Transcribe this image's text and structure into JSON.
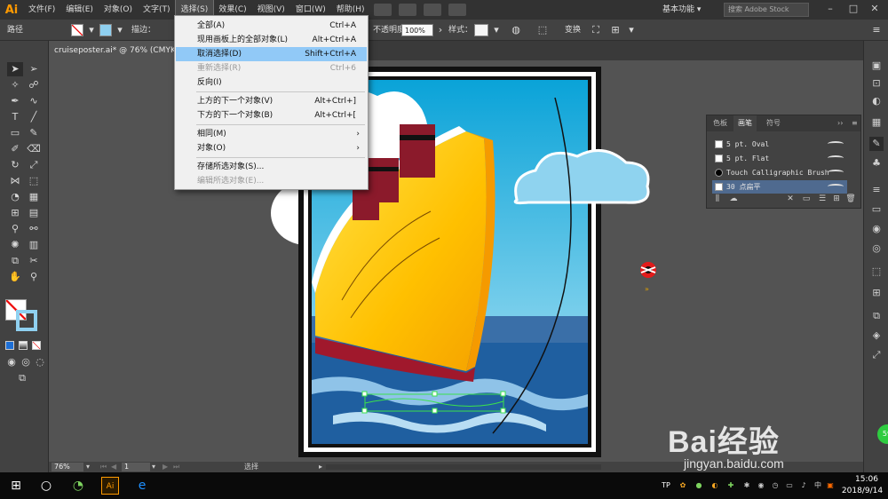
{
  "app": {
    "logo": "Ai"
  },
  "menubar": {
    "items": [
      "文件(F)",
      "编辑(E)",
      "对象(O)",
      "文字(T)",
      "选择(S)",
      "效果(C)",
      "视图(V)",
      "窗口(W)",
      "帮助(H)"
    ],
    "workspace": "基本功能 ▾",
    "stock_search_placeholder": "搜索 Adobe Stock"
  },
  "controlbar": {
    "selection_label": "路径",
    "stroke_label": "描边：",
    "opacity_label": "不透明度：",
    "opacity_value": "100%",
    "style_label": "样式：",
    "transform_label": "变换"
  },
  "document": {
    "tab_title": "cruiseposter.ai* @ 76% (CMYK/"
  },
  "select_menu": {
    "items": [
      {
        "label": "全部(A)",
        "shortcut": "Ctrl+A",
        "state": "normal"
      },
      {
        "label": "现用画板上的全部对象(L)",
        "shortcut": "Alt+Ctrl+A",
        "state": "normal"
      },
      {
        "label": "取消选择(D)",
        "shortcut": "Shift+Ctrl+A",
        "state": "highlighted"
      },
      {
        "label": "重新选择(R)",
        "shortcut": "Ctrl+6",
        "state": "disabled"
      },
      {
        "label": "反向(I)",
        "shortcut": "",
        "state": "normal"
      },
      {
        "label": "上方的下一个对象(V)",
        "shortcut": "Alt+Ctrl+]",
        "state": "normal"
      },
      {
        "label": "下方的下一个对象(B)",
        "shortcut": "Alt+Ctrl+[",
        "state": "normal"
      },
      {
        "label": "相同(M)",
        "shortcut": "",
        "state": "submenu"
      },
      {
        "label": "对象(O)",
        "shortcut": "",
        "state": "submenu"
      },
      {
        "label": "存储所选对象(S)...",
        "shortcut": "",
        "state": "normal"
      },
      {
        "label": "编辑所选对象(E)...",
        "shortcut": "",
        "state": "disabled"
      }
    ]
  },
  "brush_panel": {
    "tabs": [
      "色板",
      "画笔",
      "符号"
    ],
    "active_tab": "画笔",
    "brushes": [
      "5 pt. Oval",
      "5 pt. Flat",
      "Touch Calligraphic Brush",
      "30 点扁平"
    ],
    "selected_brush": "30 点扁平"
  },
  "statusbar": {
    "zoom": "76%",
    "artboard": "1",
    "tool_status": "选择"
  },
  "taskbar": {
    "time": "15:06",
    "date": "2018/9/14"
  },
  "watermark": {
    "brand": "Bai经验",
    "url": "jingyan.baidu.com",
    "badge": "59"
  },
  "colors": {
    "accent_orange": "#ff9a00",
    "menu_highlight": "#91c9f7",
    "selected_brush": "#4f6a8f",
    "sky": "#0fa6d6",
    "sea": "#1f5fa0",
    "hull_yellow": "#ffcc00",
    "hull_red": "#a0182c",
    "chimney": "#8b1a2b"
  }
}
